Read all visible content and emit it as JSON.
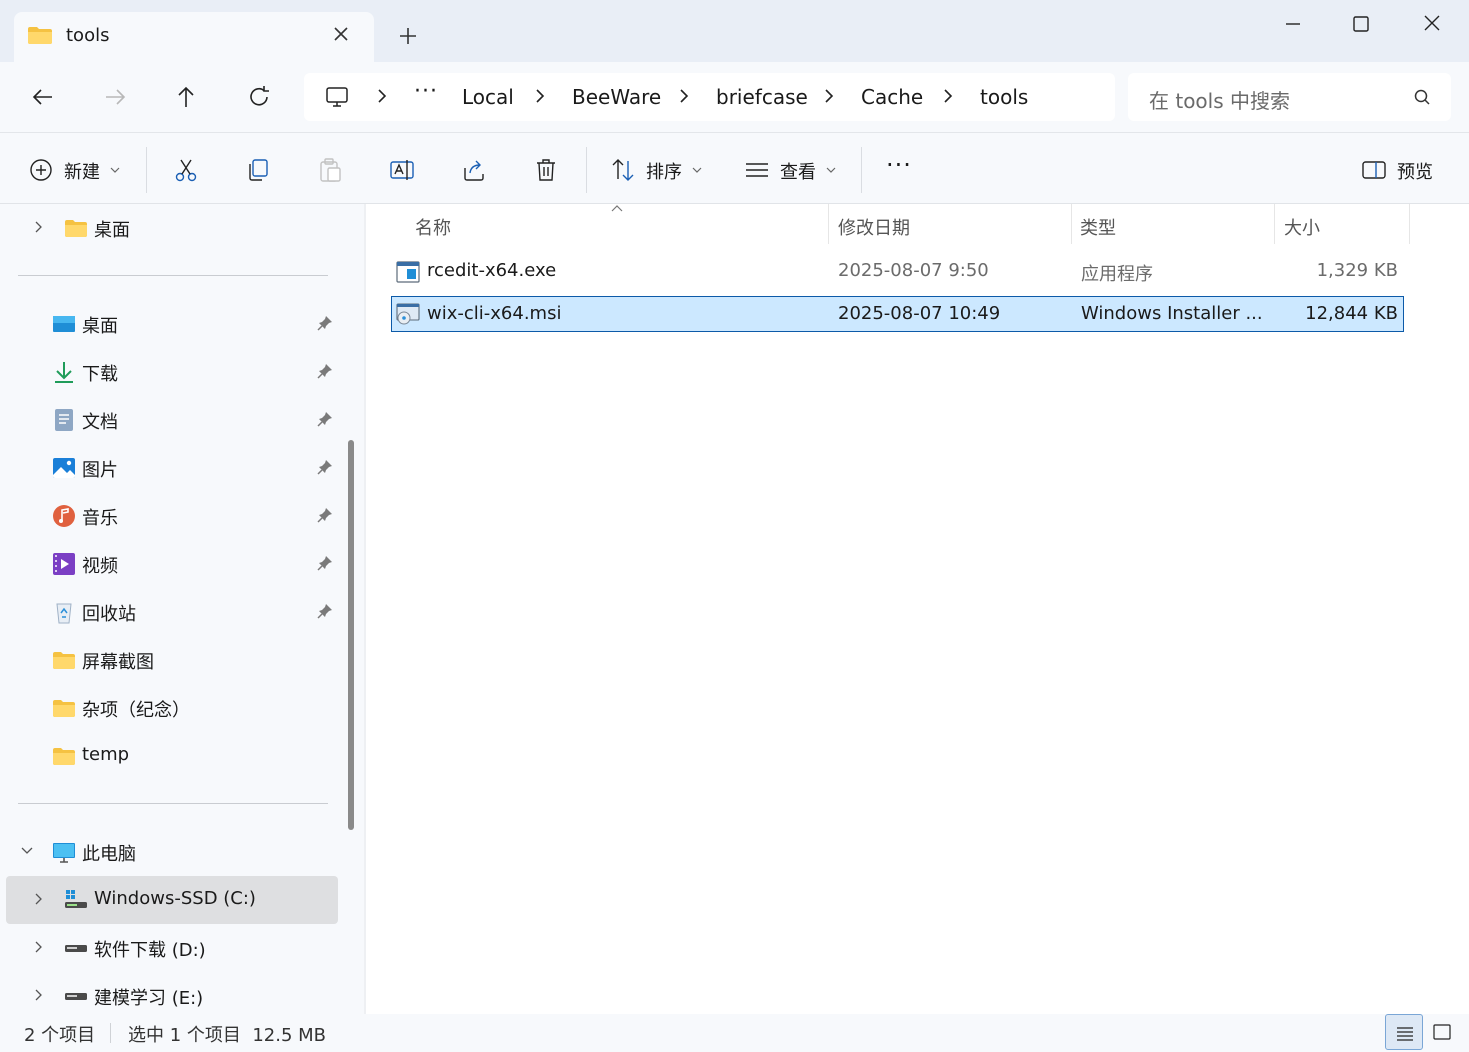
{
  "window": {
    "tab_title": "tools",
    "colors": {
      "titlebar_bg": "#e9eef6",
      "chrome_bg": "#f7f9fc",
      "selection_bg": "#cce8ff",
      "selection_border": "#0c5aa8",
      "folder": "#f5c242"
    }
  },
  "nav": {
    "breadcrumb": [
      "Local",
      "BeeWare",
      "briefcase",
      "Cache",
      "tools"
    ],
    "overflow_label": "···",
    "search_placeholder": "在 tools 中搜索"
  },
  "toolbar": {
    "new_label": "新建",
    "sort_label": "排序",
    "view_label": "查看",
    "more_label": "···",
    "preview_label": "预览",
    "icons": [
      "cut-icon",
      "copy-icon",
      "paste-icon",
      "rename-icon",
      "share-icon",
      "delete-icon"
    ]
  },
  "sidebar": {
    "top_item": "桌面",
    "quick_access": [
      {
        "label": "桌面",
        "icon": "desktop-icon",
        "pinned": true
      },
      {
        "label": "下载",
        "icon": "download-icon",
        "pinned": true
      },
      {
        "label": "文档",
        "icon": "documents-icon",
        "pinned": true
      },
      {
        "label": "图片",
        "icon": "pictures-icon",
        "pinned": true
      },
      {
        "label": "音乐",
        "icon": "music-icon",
        "pinned": true
      },
      {
        "label": "视频",
        "icon": "videos-icon",
        "pinned": true
      },
      {
        "label": "回收站",
        "icon": "recycle-bin-icon",
        "pinned": true
      },
      {
        "label": "屏幕截图",
        "icon": "folder-icon",
        "pinned": false
      },
      {
        "label": "杂项（纪念）",
        "icon": "folder-icon",
        "pinned": false
      },
      {
        "label": "temp",
        "icon": "folder-icon",
        "pinned": false
      }
    ],
    "this_pc": "此电脑",
    "drives": [
      {
        "label": "Windows-SSD (C:)",
        "selected": true
      },
      {
        "label": "软件下载 (D:)",
        "selected": false
      },
      {
        "label": "建模学习 (E:)",
        "selected": false
      }
    ]
  },
  "files": {
    "columns": [
      "名称",
      "修改日期",
      "类型",
      "大小"
    ],
    "rows": [
      {
        "name": "rcedit-x64.exe",
        "modified": "2025-08-07 9:50",
        "type": "应用程序",
        "size": "1,329 KB",
        "icon": "exe-icon",
        "selected": false
      },
      {
        "name": "wix-cli-x64.msi",
        "modified": "2025-08-07 10:49",
        "type": "Windows Installer ...",
        "size": "12,844 KB",
        "icon": "msi-icon",
        "selected": true
      }
    ]
  },
  "status": {
    "item_count": "2 个项目",
    "selection": "选中 1 个项目  12.5 MB"
  }
}
